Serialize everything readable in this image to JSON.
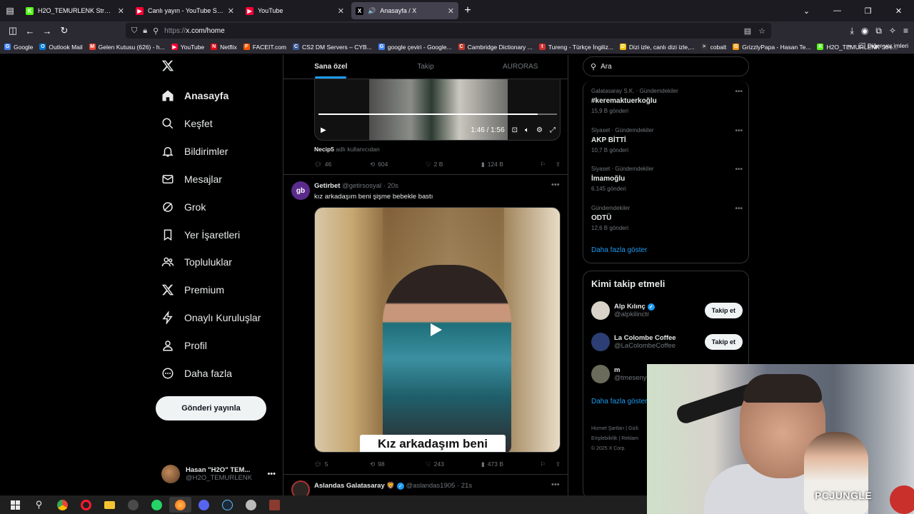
{
  "browser": {
    "tabs": [
      {
        "title": "H2O_TEMURLENK Stream - Wat",
        "favicon_color": "#53fc18",
        "favicon_glyph": "K"
      },
      {
        "title": "Canlı yayın - YouTube Studio",
        "favicon_color": "#ff0033",
        "favicon_glyph": "▶"
      },
      {
        "title": "YouTube",
        "favicon_color": "#ff0033",
        "favicon_glyph": "▶"
      },
      {
        "title": "Anasayfa / X",
        "favicon_color": "#000000",
        "favicon_glyph": "X"
      }
    ],
    "url_proto": "https://",
    "url_host": "x.com/home",
    "bookmarks": [
      {
        "label": "Google",
        "color": "#4285f4",
        "glyph": "G"
      },
      {
        "label": "Outlook Mail",
        "color": "#0078d4",
        "glyph": "O"
      },
      {
        "label": "Gelen Kutusu (626) - h...",
        "color": "#ea4335",
        "glyph": "M"
      },
      {
        "label": "YouTube",
        "color": "#ff0033",
        "glyph": "▶"
      },
      {
        "label": "Netflix",
        "color": "#e50914",
        "glyph": "N"
      },
      {
        "label": "FACEIT.com",
        "color": "#ff5500",
        "glyph": "F"
      },
      {
        "label": "CS2 DM Servers – CYB...",
        "color": "#3c5a99",
        "glyph": "C"
      },
      {
        "label": "google çeviri - Google...",
        "color": "#4285f4",
        "glyph": "G"
      },
      {
        "label": "Cambridge Dictionary ...",
        "color": "#c0392b",
        "glyph": "C"
      },
      {
        "label": "Tureng - Türkçe İngiliz...",
        "color": "#d32f2f",
        "glyph": "t"
      },
      {
        "label": "Dizi izle, canlı dizi izle,...",
        "color": "#f1c40f",
        "glyph": "D"
      },
      {
        "label": "cobalt",
        "color": "#333333",
        "glyph": ">"
      },
      {
        "label": "GrizzlyPapa - Hasan Te...",
        "color": "#f39c12",
        "glyph": "G"
      },
      {
        "label": "H2O_TEMURLENK Stre...",
        "color": "#53fc18",
        "glyph": "K"
      }
    ],
    "other_bookmarks": "Diğer yer imleri"
  },
  "nav": {
    "items": [
      {
        "label": "Anasayfa",
        "icon": "home-icon"
      },
      {
        "label": "Keşfet",
        "icon": "search-icon"
      },
      {
        "label": "Bildirimler",
        "icon": "bell-icon"
      },
      {
        "label": "Mesajlar",
        "icon": "mail-icon"
      },
      {
        "label": "Grok",
        "icon": "grok-icon"
      },
      {
        "label": "Yer İşaretleri",
        "icon": "bookmark-icon"
      },
      {
        "label": "Topluluklar",
        "icon": "people-icon"
      },
      {
        "label": "Premium",
        "icon": "x-icon"
      },
      {
        "label": "Onaylı Kuruluşlar",
        "icon": "lightning-icon"
      },
      {
        "label": "Profil",
        "icon": "person-icon"
      },
      {
        "label": "Daha fazla",
        "icon": "more-circle-icon"
      }
    ],
    "post_button": "Gönderi yayınla",
    "account": {
      "display_name": "Hasan \"H2O\" TEM...",
      "username": "@H2O_TEMURLENK"
    }
  },
  "feed": {
    "tabs": [
      "Sana özel",
      "Takip",
      "AURORAS"
    ],
    "post1": {
      "video_time": "1:46 / 1:56",
      "progress_fraction": 0.92,
      "reposted_by": "Necip5",
      "reposted_suffix": "adlı kullanıcıdan",
      "replies": "46",
      "reposts": "604",
      "likes": "2 B",
      "views": "124 B"
    },
    "post2": {
      "avatar_text": "gb",
      "display_name": "Getirbet",
      "meta": "@getirsosyal · 20s",
      "text": "kız arkadaşım beni şişme bebekle bastı",
      "caption": "Kız arkadaşım beni",
      "replies": "5",
      "reposts": "98",
      "likes": "243",
      "views": "473 B"
    },
    "post3": {
      "display_name": "Aslandas Galatasaray 🦁",
      "meta": "@aslandas1905 · 21s"
    }
  },
  "right": {
    "search_placeholder": "Ara",
    "trends": [
      {
        "category": "Galatasaray S.K. · Gündemdekiler",
        "name": "#keremaktuerkoğlu",
        "count": "15,9 B gönderi"
      },
      {
        "category": "Siyaset · Gündemdekiler",
        "name": "AKP BİTTİ",
        "count": "10,7 B gönderi"
      },
      {
        "category": "Siyaset · Gündemdekiler",
        "name": "İmamoğlu",
        "count": "6.145 gönderi"
      },
      {
        "category": "Gündemdekiler",
        "name": "ODTÜ",
        "count": "12,6 B gönderi"
      }
    ],
    "trends_more": "Daha fazla göster",
    "who_title": "Kimi takip etmeli",
    "who": [
      {
        "name": "Alp Kılınç",
        "username": "@alpkilinctr",
        "verified": true,
        "button": "Takip et",
        "color": "#d9d2c8"
      },
      {
        "name": "La Colombe Coffee",
        "username": "@LaColombeCoffee",
        "verified": false,
        "button": "Takip et",
        "color": "#2c3e73"
      },
      {
        "name": "m",
        "username": "@tmeseny",
        "verified": false,
        "button": "",
        "color": "#6b6b5b"
      }
    ],
    "who_more": "Daha fazla göster",
    "footer": [
      "Hizmet Şartları",
      "Gizli",
      "Erişilebilirlik",
      "Reklam",
      "© 2025 X Corp."
    ]
  },
  "webcam": {
    "tag": "PCJUNGLE"
  }
}
